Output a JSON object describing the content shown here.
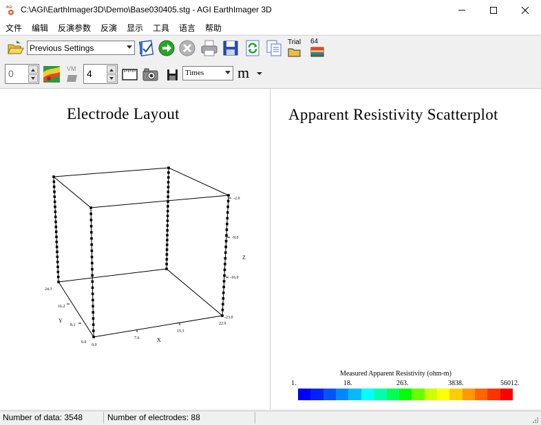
{
  "window": {
    "title": "C:\\AGI\\EarthImager3D\\Demo\\Base030405.stg - AGI EarthImager 3D",
    "app_icon_text": "AGI"
  },
  "menu": [
    "文件",
    "编辑",
    "反演参数",
    "反演",
    "显示",
    "工具",
    "语言",
    "帮助"
  ],
  "toolbar1": {
    "settings_value": "Previous Settings",
    "trial_label": "Trial",
    "bit_label": "64"
  },
  "toolbar2": {
    "spin1_value": "0",
    "vm_label": "VM",
    "spin2_value": "4",
    "font_value": "Times",
    "unit_glyph": "m"
  },
  "left_pane": {
    "title": "Electrode Layout",
    "axes": {
      "z_label": "Z",
      "x_label": "X",
      "y_label": "Y",
      "z_ticks": [
        "-2.0",
        "-9.0",
        "-16.0",
        "-23.0"
      ],
      "x_ticks": [
        "0.0",
        "7.6",
        "15.3",
        "22.9"
      ],
      "y_ticks": [
        "0.0",
        "8.1",
        "16.2",
        "24.3"
      ]
    }
  },
  "right_pane": {
    "title": "Apparent Resistivity Scatterplot",
    "legend": {
      "title": "Measured Apparent Resistivity (ohm-m)",
      "labels": [
        "1.",
        "18.",
        "263.",
        "3838.",
        "56012."
      ],
      "colors": [
        "#0000ff",
        "#0022ff",
        "#0055ff",
        "#0088ff",
        "#00bbff",
        "#00ffff",
        "#00ffaa",
        "#00ff55",
        "#00ff00",
        "#66ff00",
        "#ccff00",
        "#ffff00",
        "#ffcc00",
        "#ff9900",
        "#ff6600",
        "#ff3300",
        "#ff0000"
      ]
    }
  },
  "status": {
    "data_count": "Number of data: 3548",
    "electrode_count": "Number of electrodes: 88"
  }
}
